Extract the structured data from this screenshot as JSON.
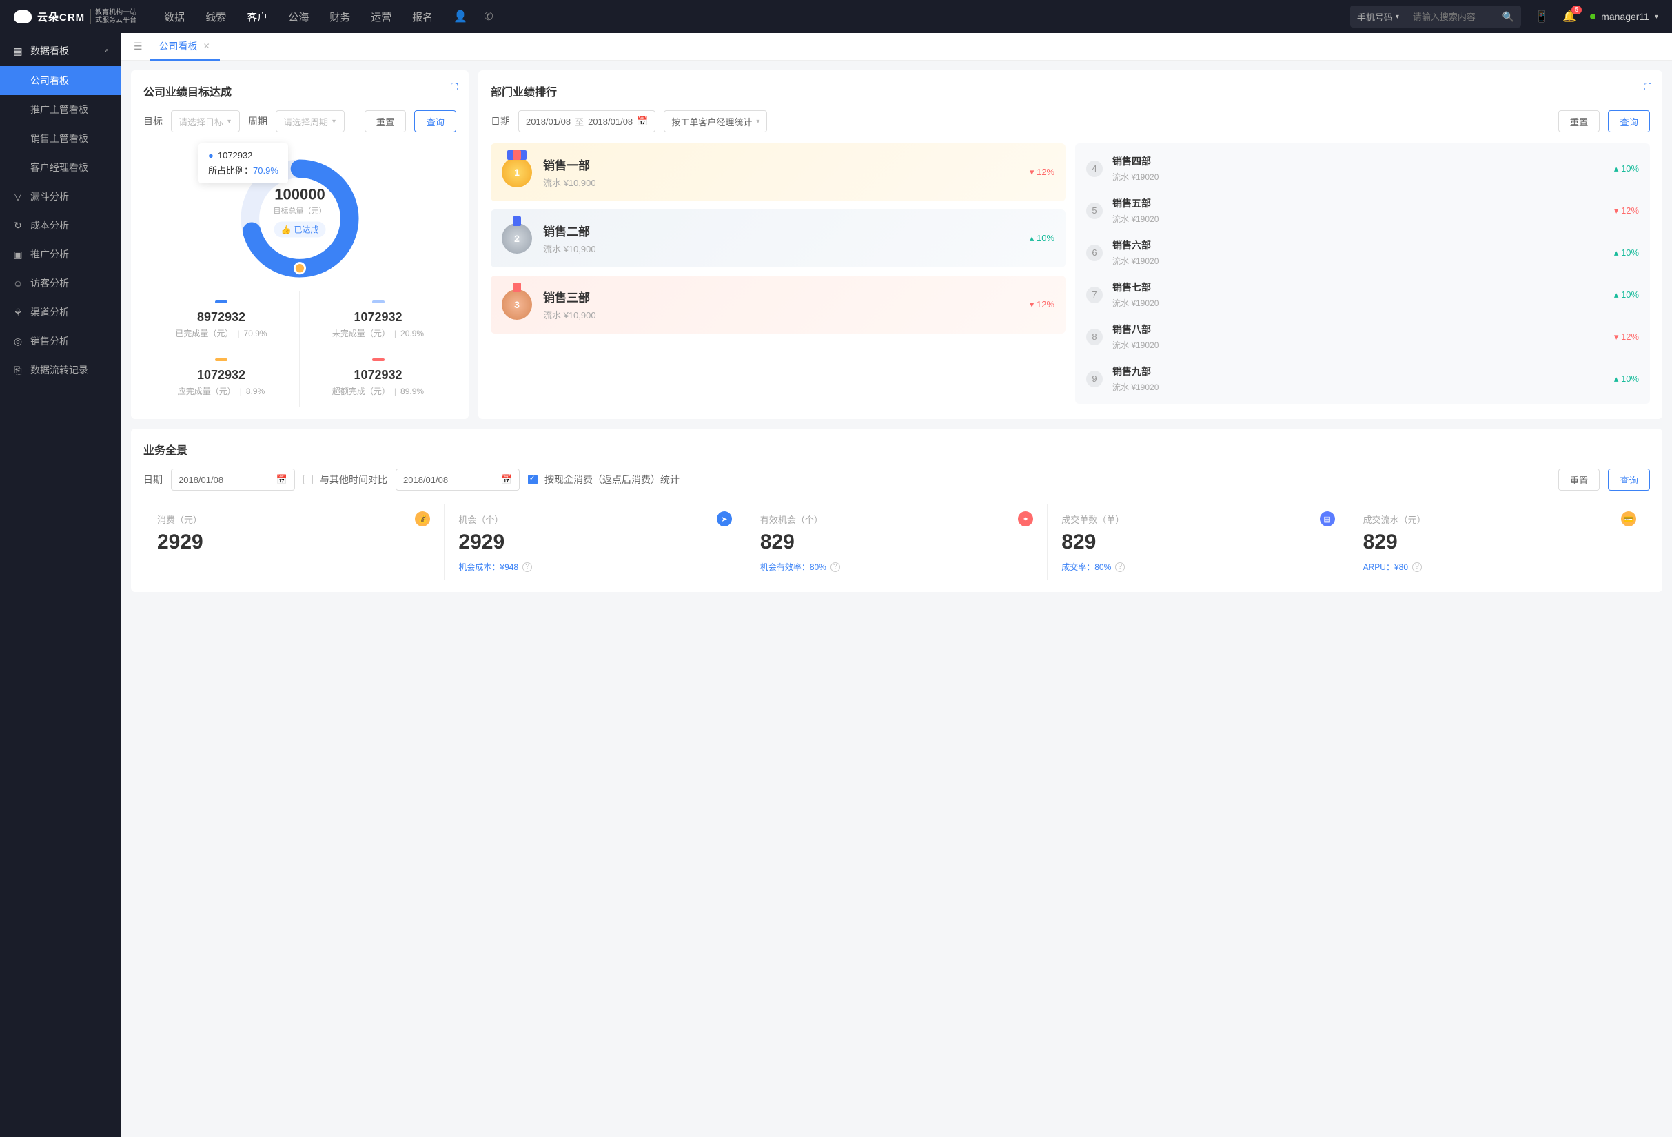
{
  "header": {
    "logo_text": "云朵CRM",
    "logo_sub_l1": "教育机构一站",
    "logo_sub_l2": "式服务云平台",
    "nav": [
      "数据",
      "线索",
      "客户",
      "公海",
      "财务",
      "运营",
      "报名"
    ],
    "nav_active": 2,
    "search_type": "手机号码",
    "search_placeholder": "请输入搜索内容",
    "badge": "5",
    "user": "manager11"
  },
  "sidebar": {
    "group_title": "数据看板",
    "group_items": [
      "公司看板",
      "推广主管看板",
      "销售主管看板",
      "客户经理看板"
    ],
    "items": [
      {
        "icon": "▽",
        "label": "漏斗分析"
      },
      {
        "icon": "↻",
        "label": "成本分析"
      },
      {
        "icon": "▣",
        "label": "推广分析"
      },
      {
        "icon": "☺",
        "label": "访客分析"
      },
      {
        "icon": "⚘",
        "label": "渠道分析"
      },
      {
        "icon": "◎",
        "label": "销售分析"
      },
      {
        "icon": "⎘",
        "label": "数据流转记录"
      }
    ]
  },
  "tab": {
    "label": "公司看板"
  },
  "goal": {
    "title": "公司业绩目标达成",
    "target_label": "目标",
    "target_placeholder": "请选择目标",
    "period_label": "周期",
    "period_placeholder": "请选择周期",
    "reset": "重置",
    "query": "查询",
    "center_value": "100000",
    "center_label": "目标总量（元）",
    "center_badge": "已达成",
    "tooltip_val": "1072932",
    "tooltip_ratio_label": "所占比例：",
    "tooltip_ratio": "70.9%",
    "stats": [
      {
        "color": "#3b82f6",
        "value": "8972932",
        "label": "已完成量（元）",
        "pct": "70.9%"
      },
      {
        "color": "#a9c8ff",
        "value": "1072932",
        "label": "未完成量（元）",
        "pct": "20.9%"
      },
      {
        "color": "#ffb547",
        "value": "1072932",
        "label": "应完成量（元）",
        "pct": "8.9%"
      },
      {
        "color": "#ff6b6b",
        "value": "1072932",
        "label": "超额完成（元）",
        "pct": "89.9%"
      }
    ]
  },
  "ranking": {
    "title": "部门业绩排行",
    "date_label": "日期",
    "date_from": "2018/01/08",
    "date_sep": "至",
    "date_to": "2018/01/08",
    "stat_by": "按工单客户经理统计",
    "reset": "重置",
    "query": "查询",
    "top": [
      {
        "rank": "1",
        "name": "销售一部",
        "value": "流水 ¥10,900",
        "pct": "12%",
        "dir": "down"
      },
      {
        "rank": "2",
        "name": "销售二部",
        "value": "流水 ¥10,900",
        "pct": "10%",
        "dir": "up"
      },
      {
        "rank": "3",
        "name": "销售三部",
        "value": "流水 ¥10,900",
        "pct": "12%",
        "dir": "down"
      }
    ],
    "rest": [
      {
        "rank": "4",
        "name": "销售四部",
        "value": "流水 ¥19020",
        "pct": "10%",
        "dir": "up"
      },
      {
        "rank": "5",
        "name": "销售五部",
        "value": "流水 ¥19020",
        "pct": "12%",
        "dir": "down"
      },
      {
        "rank": "6",
        "name": "销售六部",
        "value": "流水 ¥19020",
        "pct": "10%",
        "dir": "up"
      },
      {
        "rank": "7",
        "name": "销售七部",
        "value": "流水 ¥19020",
        "pct": "10%",
        "dir": "up"
      },
      {
        "rank": "8",
        "name": "销售八部",
        "value": "流水 ¥19020",
        "pct": "12%",
        "dir": "down"
      },
      {
        "rank": "9",
        "name": "销售九部",
        "value": "流水 ¥19020",
        "pct": "10%",
        "dir": "up"
      }
    ]
  },
  "panorama": {
    "title": "业务全景",
    "date_label": "日期",
    "date1": "2018/01/08",
    "compare_label": "与其他时间对比",
    "date2": "2018/01/08",
    "cash_label": "按现金消费（返点后消费）统计",
    "reset": "重置",
    "query": "查询",
    "stats": [
      {
        "label": "消费（元）",
        "value": "2929",
        "icon_bg": "#ffb547",
        "icon": "💰",
        "sub_label": "",
        "sub_val": ""
      },
      {
        "label": "机会（个）",
        "value": "2929",
        "icon_bg": "#3b82f6",
        "icon": "➤",
        "sub_label": "机会成本：",
        "sub_val": "¥948"
      },
      {
        "label": "有效机会（个）",
        "value": "829",
        "icon_bg": "#ff6b6b",
        "icon": "✦",
        "sub_label": "机会有效率：",
        "sub_val": "80%"
      },
      {
        "label": "成交单数（单）",
        "value": "829",
        "icon_bg": "#5b7cff",
        "icon": "▤",
        "sub_label": "成交率：",
        "sub_val": "80%"
      },
      {
        "label": "成交流水（元）",
        "value": "829",
        "icon_bg": "#ffb547",
        "icon": "💳",
        "sub_label": "ARPU：",
        "sub_val": "¥80"
      }
    ]
  },
  "chart_data": {
    "type": "pie",
    "title": "公司业绩目标达成",
    "total": 100000,
    "unit": "元",
    "series": [
      {
        "name": "已完成量",
        "value": 8972932,
        "pct": 70.9,
        "color": "#3b82f6"
      },
      {
        "name": "未完成量",
        "value": 1072932,
        "pct": 20.9,
        "color": "#a9c8ff"
      },
      {
        "name": "应完成量",
        "value": 1072932,
        "pct": 8.9,
        "color": "#ffb547"
      },
      {
        "name": "超额完成",
        "value": 1072932,
        "pct": 89.9,
        "color": "#ff6b6b"
      }
    ]
  }
}
